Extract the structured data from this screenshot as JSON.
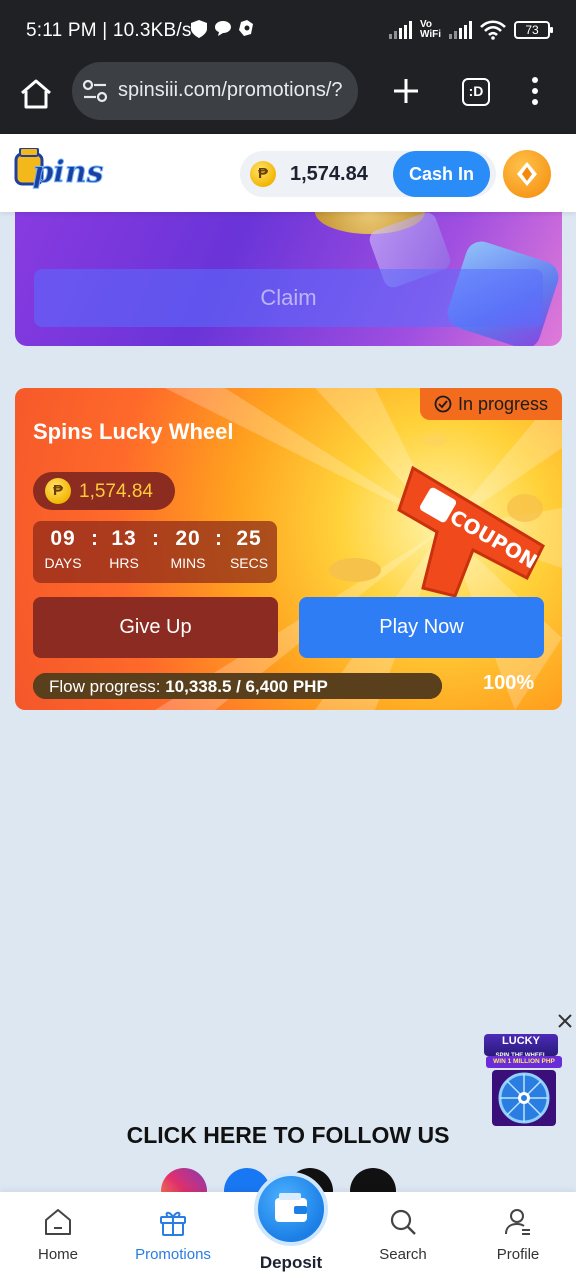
{
  "status_bar": {
    "time": "5:11 PM | 10.3KB/s",
    "volte": "Vo\nWiFi",
    "battery": "73"
  },
  "browser": {
    "url": "spinsiii.com/promotions/?",
    "tabs_label": ":D"
  },
  "header": {
    "logo_text": "pins",
    "currency_symbol": "₱",
    "balance": "1,574.84",
    "cash_in_label": "Cash In"
  },
  "promo_top": {
    "claim_label": "Claim"
  },
  "lucky_wheel": {
    "status": "In progress",
    "title": "Spins Lucky Wheel",
    "currency_symbol": "₱",
    "balance": "1,574.84",
    "countdown": [
      {
        "value": "09",
        "unit": "DAYS"
      },
      {
        "value": "13",
        "unit": "HRS"
      },
      {
        "value": "20",
        "unit": "MINS"
      },
      {
        "value": "25",
        "unit": "SECS"
      }
    ],
    "separator": ":",
    "give_up_label": "Give Up",
    "play_now_label": "Play Now",
    "flow_label": "Flow progress:",
    "flow_value": "10,338.5 / 6,400",
    "flow_unit": "PHP",
    "flow_percent": "100%",
    "flow_fraction": 1.0,
    "coupon_text": "COUPON"
  },
  "floating_widget": {
    "title": "LUCKY",
    "subtitle": "SPIN THE WHEEL",
    "banner": "WIN 1 MILLION PHP"
  },
  "follow": {
    "title": "CLICK HERE TO FOLLOW US",
    "socials": [
      "instagram-icon",
      "facebook-icon",
      "x-icon",
      "tiktok-icon"
    ]
  },
  "bottom_nav": {
    "items": [
      {
        "label": "Home",
        "icon": "home-icon"
      },
      {
        "label": "Promotions",
        "icon": "gift-icon"
      },
      {
        "label": "Deposit",
        "icon": "wallet-icon"
      },
      {
        "label": "Search",
        "icon": "search-icon"
      },
      {
        "label": "Profile",
        "icon": "profile-icon"
      }
    ]
  },
  "colors": {
    "accent": "#2a8cf7",
    "card_orange": "#f4562a",
    "active_nav": "#2a7de1",
    "coin_gold": "#f2b705"
  }
}
